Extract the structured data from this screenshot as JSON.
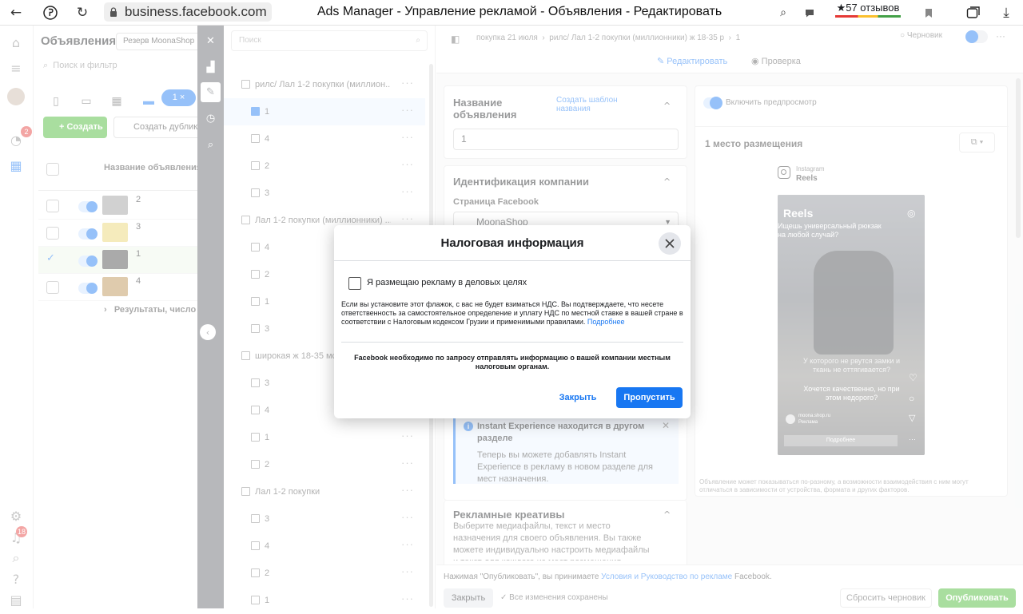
{
  "browser": {
    "url": "business.facebook.com",
    "window_title": "Ads Manager - Управление рекламой - Объявления - Редактировать",
    "reviews": "★57 отзывов"
  },
  "left_nav": {
    "badge_1": "2",
    "badge_2": "18"
  },
  "ads_panel": {
    "title": "Объявления",
    "account": "Резерв MoonaShop",
    "search_placeholder": "Поиск и фильтр",
    "selected_chip": "1 ×",
    "create_button": "+ Создать",
    "duplicate_button": "Создать дубликат",
    "column_header": "Название объявления",
    "rows": [
      {
        "name": "2"
      },
      {
        "name": "3"
      },
      {
        "name": "1"
      },
      {
        "name": "4"
      }
    ],
    "results_row": "Результаты, число"
  },
  "tree": {
    "search_placeholder": "Поиск",
    "nodes": [
      {
        "label": "рилс/ Лал 1-2 покупки (миллион...",
        "level": "adset"
      },
      {
        "label": "1",
        "level": "ad"
      },
      {
        "label": "4",
        "level": "ad"
      },
      {
        "label": "2",
        "level": "ad"
      },
      {
        "label": "3",
        "level": "ad"
      },
      {
        "label": "Лал 1-2 покупки (миллионники) ...",
        "level": "adset"
      },
      {
        "label": "4",
        "level": "ad"
      },
      {
        "label": "2",
        "level": "ad"
      },
      {
        "label": "1",
        "level": "ad"
      },
      {
        "label": "3",
        "level": "ad"
      },
      {
        "label": "широкая ж 18-35 мск",
        "level": "adset"
      },
      {
        "label": "3",
        "level": "ad"
      },
      {
        "label": "4",
        "level": "ad"
      },
      {
        "label": "1",
        "level": "ad"
      },
      {
        "label": "2",
        "level": "ad"
      },
      {
        "label": "Лал 1-2 покупки",
        "level": "adset"
      },
      {
        "label": "3",
        "level": "ad"
      },
      {
        "label": "4",
        "level": "ad"
      },
      {
        "label": "2",
        "level": "ad"
      },
      {
        "label": "1",
        "level": "ad"
      }
    ]
  },
  "editor": {
    "breadcrumb": [
      "покупка 21 июля",
      "рилс/ Лал 1-2 покупки (миллионники) ж 18-35 р",
      "1"
    ],
    "status": "○ Черновик",
    "tab_edit": "Редактировать",
    "tab_review": "Проверка",
    "ad_name_title": "Название объявления",
    "ad_name_template_link": "Создать шаблон названия",
    "ad_name_value": "1",
    "identity_title": "Идентификация компании",
    "facebook_page_label": "Страница Facebook",
    "facebook_page_value": "MoonaShop",
    "instant_title": "Instant Experience находится в другом разделе",
    "instant_body": "Теперь вы можете добавлять Instant Experience в рекламу в новом разделе для мест назначения.",
    "creatives_title": "Рекламные креативы",
    "creatives_body": "Выберите медиафайлы, текст и место назначения для своего объявления. Вы также можете индивидуально настроить медиафайлы и текст для каждого из мест размещения. Подробнее",
    "preview_toggle": "Включить предпросмотр",
    "placement_label": "1 место размещения",
    "platform": "Instagram",
    "platform_sub": "Reels",
    "reel_header": "Reels",
    "reel_text_1": "Ищешь универсальный рюкзак на любой случай?",
    "reel_text_2": "У которого не рвутся замки и ткань не оттягивается?",
    "reel_text_3": "Хочется качественно, но при этом недорого?",
    "reel_account": "moona.shop.ru",
    "reel_sponsored": "Реклама",
    "reel_cta": "Подробнее",
    "preview_disclaimer": "Объявление может показываться по-разному, а возможности взаимодействия с ним могут отличаться в зависимости от устройства, формата и других факторов.",
    "footer_terms_prefix": "Нажимая \"Опубликовать\", вы принимаете ",
    "footer_terms_link": "Условия и Руководство по рекламе",
    "footer_terms_suffix": " Facebook.",
    "footer_close": "Закрыть",
    "footer_saved": "✓ Все изменения сохранены",
    "footer_reset": "Сбросить черновик",
    "footer_publish": "Опубликовать"
  },
  "modal": {
    "title": "Налоговая информация",
    "checkbox_label": "Я размещаю рекламу в деловых целях",
    "description": "Если вы установите этот флажок, с вас не будет взиматься НДС. Вы подтверждаете, что несете ответственность за самостоятельное определение и уплату НДС по местной ставке в вашей стране в соответствии с Налоговым кодексом Грузии и применимыми правилами.",
    "description_link": "Подробнее",
    "note": "Facebook необходимо по запросу отправлять информацию о вашей компании местным налоговым органам.",
    "close_button": "Закрыть",
    "skip_button": "Пропустить"
  }
}
